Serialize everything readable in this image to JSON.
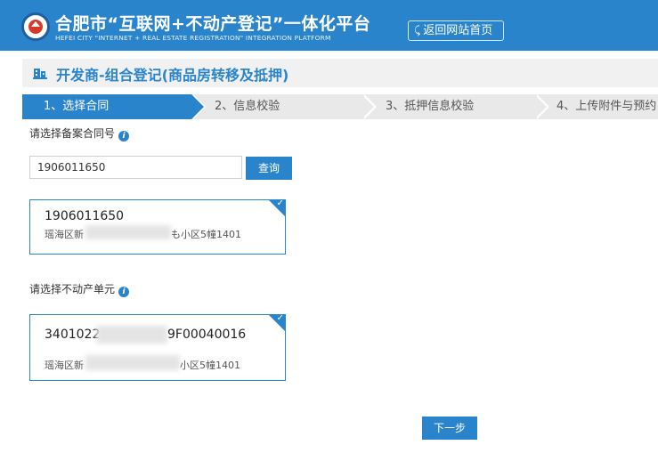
{
  "header": {
    "title": "合肥市“互联网+不动产登记”一体化平台",
    "subtitle": "HEFEI CITY \"INTERNET + REAL ESTATE REGISTRATION\" INTEGRATION PLATFORM",
    "back_label": "返回网站首页",
    "colors": {
      "brand": "#2a84cc",
      "bar_background": "#f1f1f1"
    }
  },
  "page": {
    "title": "开发商-组合登记(商品房转移及抵押)"
  },
  "steps": [
    {
      "label": "1、选择合同",
      "active": true
    },
    {
      "label": "2、信息校验",
      "active": false
    },
    {
      "label": "3、抵押信息校验",
      "active": false
    },
    {
      "label": "4、上传附件与预约",
      "active": false
    }
  ],
  "contract": {
    "label": "请选择备案合同号",
    "input_value": "1906011650",
    "query_label": "查询",
    "card": {
      "number": "1906011650",
      "address_left": "瑶海区新",
      "address_right": "も小区5幢1401"
    }
  },
  "unit": {
    "label": "请选择不动产单元",
    "card": {
      "number_left": "3401022",
      "number_right": "9F00040016",
      "address_left": "瑶海区新",
      "address_right": "小区5幢1401"
    }
  },
  "next_label": "下一步",
  "icons": {
    "info": "info-icon",
    "check": "check-icon",
    "back": "back-arrow-icon",
    "title": "building-icon"
  }
}
